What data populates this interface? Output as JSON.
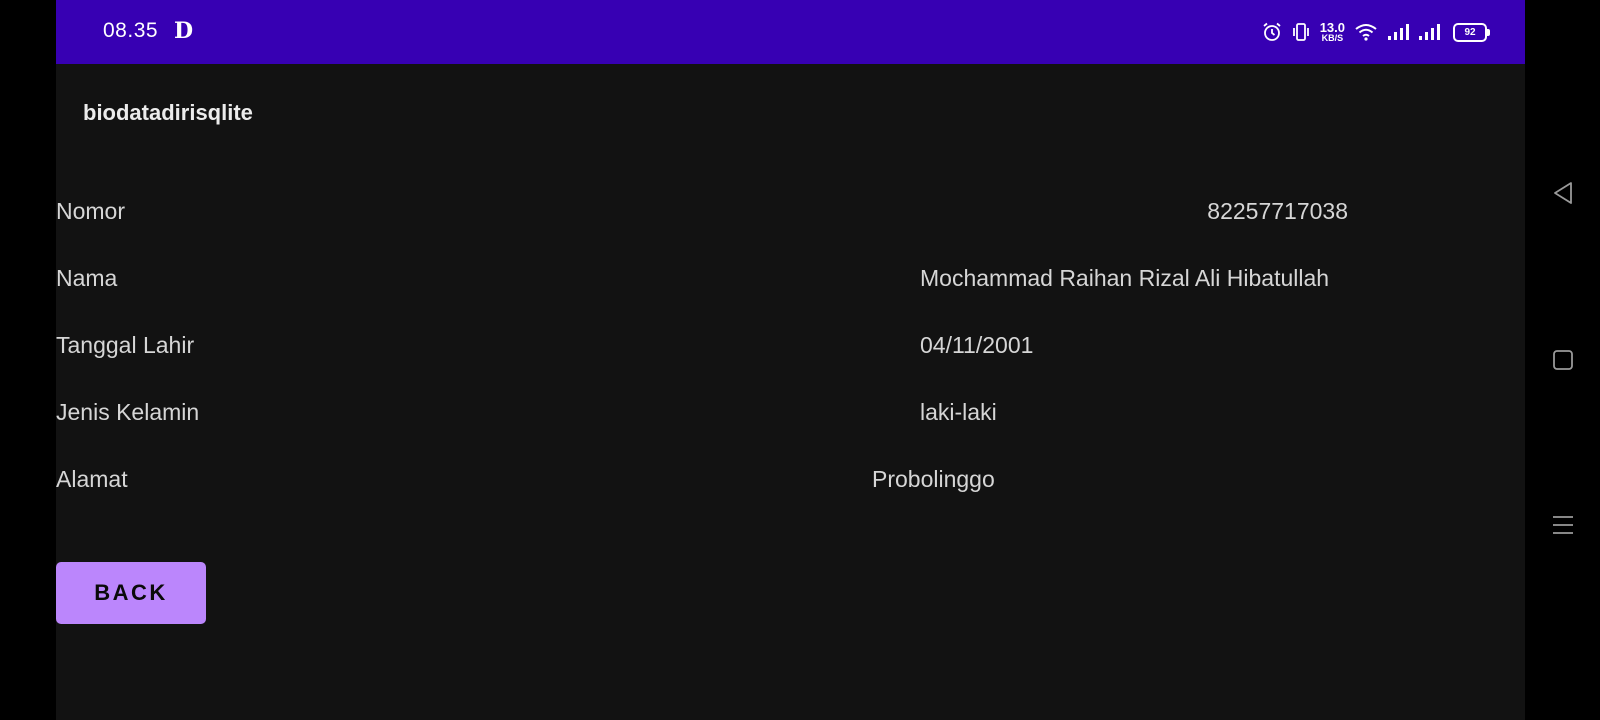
{
  "status_bar": {
    "time": "08.35",
    "app_glyph": "D",
    "icons": [
      "alarm-icon",
      "vibrate-icon",
      "wifi-icon",
      "signal-icon",
      "signal-icon"
    ],
    "net_speed_value": "13.0",
    "net_speed_unit": "KB/S",
    "battery": "92"
  },
  "app_bar": {
    "title": "biodatadirisqlite"
  },
  "fields": [
    {
      "label": "Nomor",
      "value": "82257717038"
    },
    {
      "label": "Nama",
      "value": "Mochammad Raihan Rizal Ali Hibatullah"
    },
    {
      "label": "Tanggal Lahir",
      "value": "04/11/2001"
    },
    {
      "label": "Jenis Kelamin",
      "value": "laki-laki"
    },
    {
      "label": "Alamat",
      "value": "Probolinggo"
    }
  ],
  "actions": {
    "back_label": "BACK"
  },
  "nav": {
    "icons": [
      "back-triangle-icon",
      "home-square-icon",
      "menu-lines-icon"
    ]
  },
  "colors": {
    "status_bar": "#3700b3",
    "background": "#121212",
    "button": "#bb86fc",
    "text": "#d6d6d6"
  }
}
